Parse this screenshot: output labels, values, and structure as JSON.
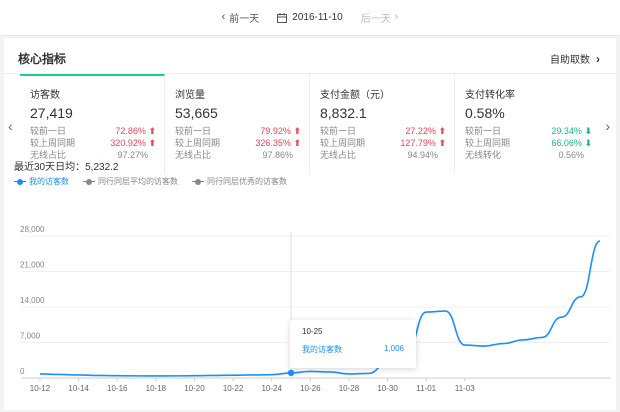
{
  "topbar": {
    "prev_label": "前一天",
    "date": "2016-11-10",
    "next_label": "后一天"
  },
  "panel": {
    "title": "核心指标",
    "custom_label": "自助取数"
  },
  "cards": [
    {
      "label": "访客数",
      "value": "27,419",
      "rows": [
        {
          "label": "较前一日",
          "value": "72.86%",
          "trend": "up"
        },
        {
          "label": "较上周同期",
          "value": "320.92%",
          "trend": "up"
        },
        {
          "label": "无线占比",
          "value": "97.27%",
          "trend": "none"
        }
      ]
    },
    {
      "label": "浏览量",
      "value": "53,665",
      "rows": [
        {
          "label": "较前一日",
          "value": "79.92%",
          "trend": "up"
        },
        {
          "label": "较上周同期",
          "value": "326.35%",
          "trend": "up"
        },
        {
          "label": "无线占比",
          "value": "97.86%",
          "trend": "none"
        }
      ]
    },
    {
      "label": "支付金额（元）",
      "value": "8,832.1",
      "rows": [
        {
          "label": "较前一日",
          "value": "27.22%",
          "trend": "up"
        },
        {
          "label": "较上周同期",
          "value": "127.79%",
          "trend": "up"
        },
        {
          "label": "无线占比",
          "value": "94.94%",
          "trend": "none"
        }
      ]
    },
    {
      "label": "支付转化率",
      "value": "0.58%",
      "rows": [
        {
          "label": "较前一日",
          "value": "29.34%",
          "trend": "down"
        },
        {
          "label": "较上周同期",
          "value": "66.06%",
          "trend": "down"
        },
        {
          "label": "无线转化",
          "value": "0.56%",
          "trend": "none"
        }
      ]
    }
  ],
  "summary": "最近30天日均：5,232.2",
  "legend": [
    "我的访客数",
    "同行同层平均的访客数",
    "同行同层优秀的访客数"
  ],
  "tooltip": {
    "date": "10-25",
    "series": "我的访客数",
    "value": "1,006"
  },
  "colors": {
    "accent": "#1890ff",
    "up": "#f0455b",
    "down": "#20b588",
    "active_tab": "#20c997"
  },
  "chart_data": {
    "type": "line",
    "ylim": [
      0,
      28000
    ],
    "y_ticks": [
      "0",
      "7,000",
      "14,000",
      "21,000",
      "28,000"
    ],
    "x_tick_labels": [
      "10-12",
      "10-14",
      "10-16",
      "10-18",
      "10-20",
      "10-22",
      "10-24",
      "10-26",
      "10-28",
      "10-30",
      "11-01",
      "11-03"
    ],
    "categories": [
      "10-12",
      "10-13",
      "10-14",
      "10-15",
      "10-16",
      "10-17",
      "10-18",
      "10-19",
      "10-20",
      "10-21",
      "10-22",
      "10-23",
      "10-24",
      "10-25",
      "10-26",
      "10-27",
      "10-28",
      "10-29",
      "10-30",
      "10-31",
      "11-01",
      "11-02",
      "11-03",
      "11-04",
      "11-05",
      "11-06",
      "11-07",
      "11-08",
      "11-09",
      "11-10"
    ],
    "series": [
      {
        "name": "我的访客数",
        "color": "#1890ff",
        "values": [
          800,
          700,
          600,
          500,
          450,
          420,
          400,
          420,
          450,
          500,
          550,
          600,
          650,
          1006,
          1300,
          1200,
          800,
          900,
          3000,
          5000,
          13000,
          13200,
          6500,
          6300,
          6800,
          7500,
          8000,
          12000,
          16000,
          27000
        ]
      }
    ]
  }
}
